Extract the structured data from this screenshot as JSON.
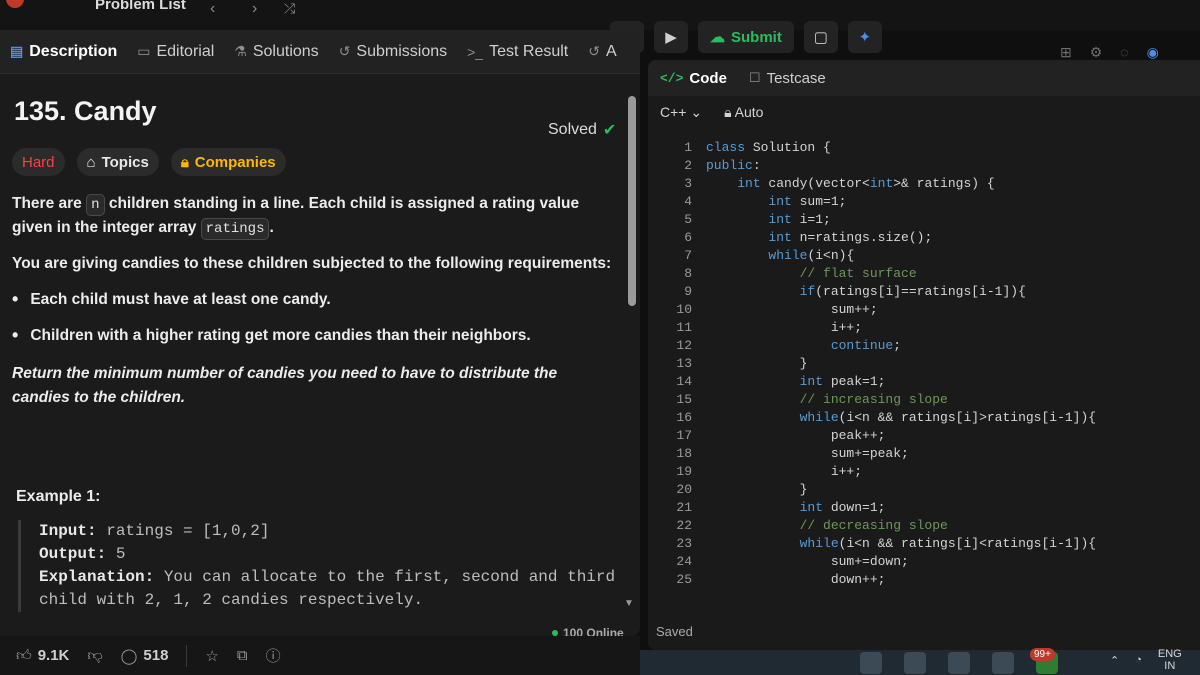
{
  "topnav": {
    "problem_list": "Problem List"
  },
  "runbar": {
    "submit_label": "Submit"
  },
  "tabs": [
    {
      "label": "Description"
    },
    {
      "label": "Editorial"
    },
    {
      "label": "Solutions"
    },
    {
      "label": "Submissions"
    },
    {
      "label": "Test Result"
    },
    {
      "label": "A"
    }
  ],
  "problem": {
    "title": "135. Candy",
    "status": "Solved",
    "difficulty": "Hard",
    "topics_label": "Topics",
    "companies_label": "Companies"
  },
  "description": {
    "p1_a": "There are",
    "p1_code1": "n",
    "p1_b": "children standing in a line. Each child is assigned a rating value given in the integer array",
    "p1_code2": "ratings",
    "p1_c": ".",
    "p2": "You are giving candies to these children subjected to the following requirements:",
    "bullet1": "Each child must have at least one candy.",
    "bullet2": "Children with a higher rating get more candies than their neighbors.",
    "p3": "Return the minimum number of candies you need to have to distribute the candies to the children."
  },
  "example1": {
    "title": "Example 1:",
    "input_label": "Input:",
    "input_value": "ratings = [1,0,2]",
    "output_label": "Output:",
    "output_value": "5",
    "explanation_label": "Explanation:",
    "explanation_value": "You can allocate to the first, second and third child with 2, 1, 2 candies respectively."
  },
  "status": {
    "online": "100 Online"
  },
  "footer": {
    "likes": "9.1K",
    "comments": "518"
  },
  "editor": {
    "tab_code": "Code",
    "tab_testcase": "Testcase",
    "language": "C++",
    "mode": "Auto",
    "saved": "Saved",
    "lines": [
      "class Solution {",
      "public:",
      "    int candy(vector<int>& ratings) {",
      "        int sum=1;",
      "        int i=1;",
      "        int n=ratings.size();",
      "        while(i<n){",
      "            // flat surface",
      "            if(ratings[i]==ratings[i-1]){",
      "                sum++;",
      "                i++;",
      "                continue;",
      "            }",
      "            int peak=1;",
      "            // increasing slope",
      "            while(i<n && ratings[i]>ratings[i-1]){",
      "                peak++;",
      "                sum+=peak;",
      "                i++;",
      "            }",
      "            int down=1;",
      "            // decreasing slope",
      "            while(i<n && ratings[i]<ratings[i-1]){",
      "                sum+=down;",
      "                down++;"
    ]
  },
  "taskbar": {
    "badge": "99+",
    "lang_top": "ENG",
    "lang_bottom": "IN"
  }
}
